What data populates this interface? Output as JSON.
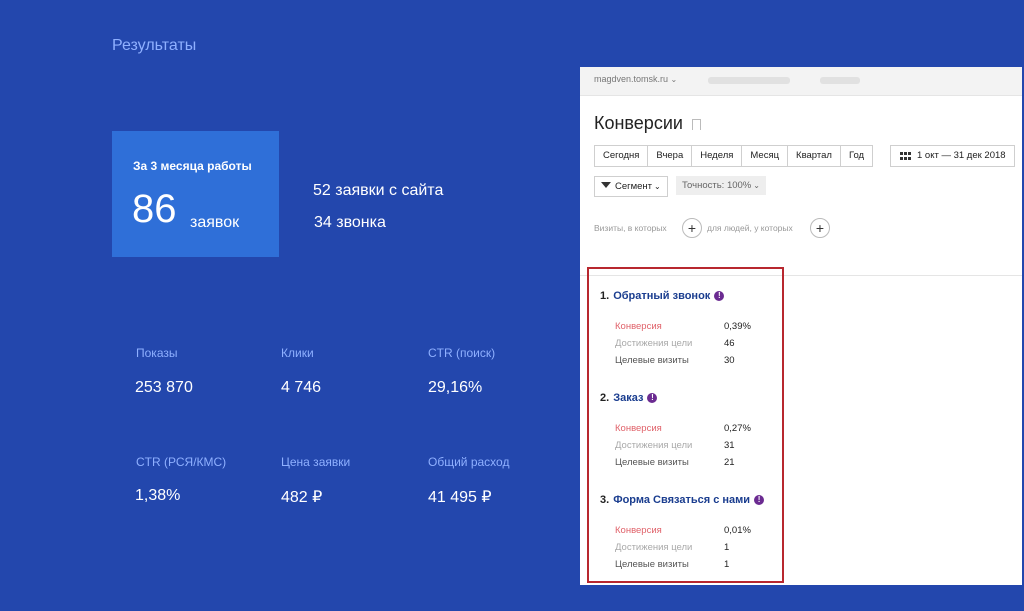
{
  "results": {
    "title": "Результаты",
    "hero": {
      "caption": "За 3 месяца работы",
      "number": "86",
      "unit": "заявок"
    },
    "site_requests": "52 заявки с сайта",
    "calls": "34 звонка"
  },
  "metrics": [
    {
      "label": "Показы",
      "value": "253 870"
    },
    {
      "label": "Клики",
      "value": "4 746"
    },
    {
      "label": "CTR (поиск)",
      "value": "29,16%"
    },
    {
      "label": "CTR (РСЯ/КМС)",
      "value": "1,38%"
    },
    {
      "label": "Цена заявки",
      "value": "482 ₽"
    },
    {
      "label": "Общий расход",
      "value": "41 495 ₽"
    }
  ],
  "panel": {
    "site": "magdven.tomsk.ru",
    "title": "Конверсии",
    "periods": [
      "Сегодня",
      "Вчера",
      "Неделя",
      "Месяц",
      "Квартал",
      "Год"
    ],
    "date_range": "1 окт — 31 дек 2018",
    "segment": "Сегмент",
    "accuracy": "Точность: 100%",
    "visits_where": "Визиты, в которых",
    "people_where": "для людей, у которых",
    "plus": "+"
  },
  "goals": [
    {
      "num": "1.",
      "name": "Обратный звонок",
      "conversion_label": "Конверсия",
      "conversion": "0,39%",
      "achievements_label": "Достижения цели",
      "achievements": "46",
      "visits_label": "Целевые визиты",
      "visits": "30"
    },
    {
      "num": "2.",
      "name": "Заказ",
      "conversion_label": "Конверсия",
      "conversion": "0,27%",
      "achievements_label": "Достижения цели",
      "achievements": "31",
      "visits_label": "Целевые визиты",
      "visits": "21"
    },
    {
      "num": "3.",
      "name": "Форма Связаться с нами",
      "conversion_label": "Конверсия",
      "conversion": "0,01%",
      "achievements_label": "Достижения цели",
      "achievements": "1",
      "visits_label": "Целевые визиты",
      "visits": "1"
    }
  ],
  "colors": {
    "background": "#2347ad",
    "hero": "#2f6fd8",
    "label": "#8fb0ff",
    "frame": "#b8282f",
    "goal_link": "#1a3d8f"
  },
  "icons": {
    "info": "!",
    "calendar": "calendar-icon",
    "filter": "filter-icon"
  }
}
